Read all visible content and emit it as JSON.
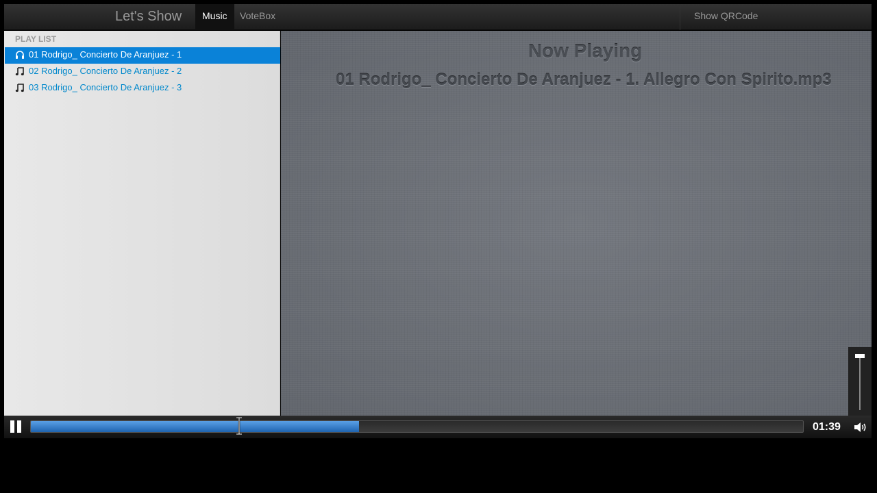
{
  "navbar": {
    "brand": "Let's Show",
    "tabs": [
      {
        "label": "Music",
        "active": true
      },
      {
        "label": "VoteBox",
        "active": false
      }
    ],
    "show_qrcode": "Show QRCode"
  },
  "sidebar": {
    "header": "PLAY LIST",
    "items": [
      {
        "label": "01 Rodrigo_ Concierto De Aranjuez - 1",
        "icon": "headphones-icon",
        "active": true
      },
      {
        "label": "02 Rodrigo_ Concierto De Aranjuez - 2",
        "icon": "music-note-icon",
        "active": false
      },
      {
        "label": "03 Rodrigo_ Concierto De Aranjuez - 3",
        "icon": "music-note-icon",
        "active": false
      }
    ]
  },
  "now_playing": {
    "title": "Now Playing",
    "track": "01 Rodrigo_ Concierto De Aranjuez - 1. Allegro Con Spirito.mp3"
  },
  "player": {
    "time": "01:39",
    "progress_fraction": 0.425,
    "volume_fraction": 1.0,
    "state": "playing"
  },
  "colors": {
    "accent": "#0a82d8",
    "link": "#0088cc",
    "progress": "#3a82d0"
  }
}
